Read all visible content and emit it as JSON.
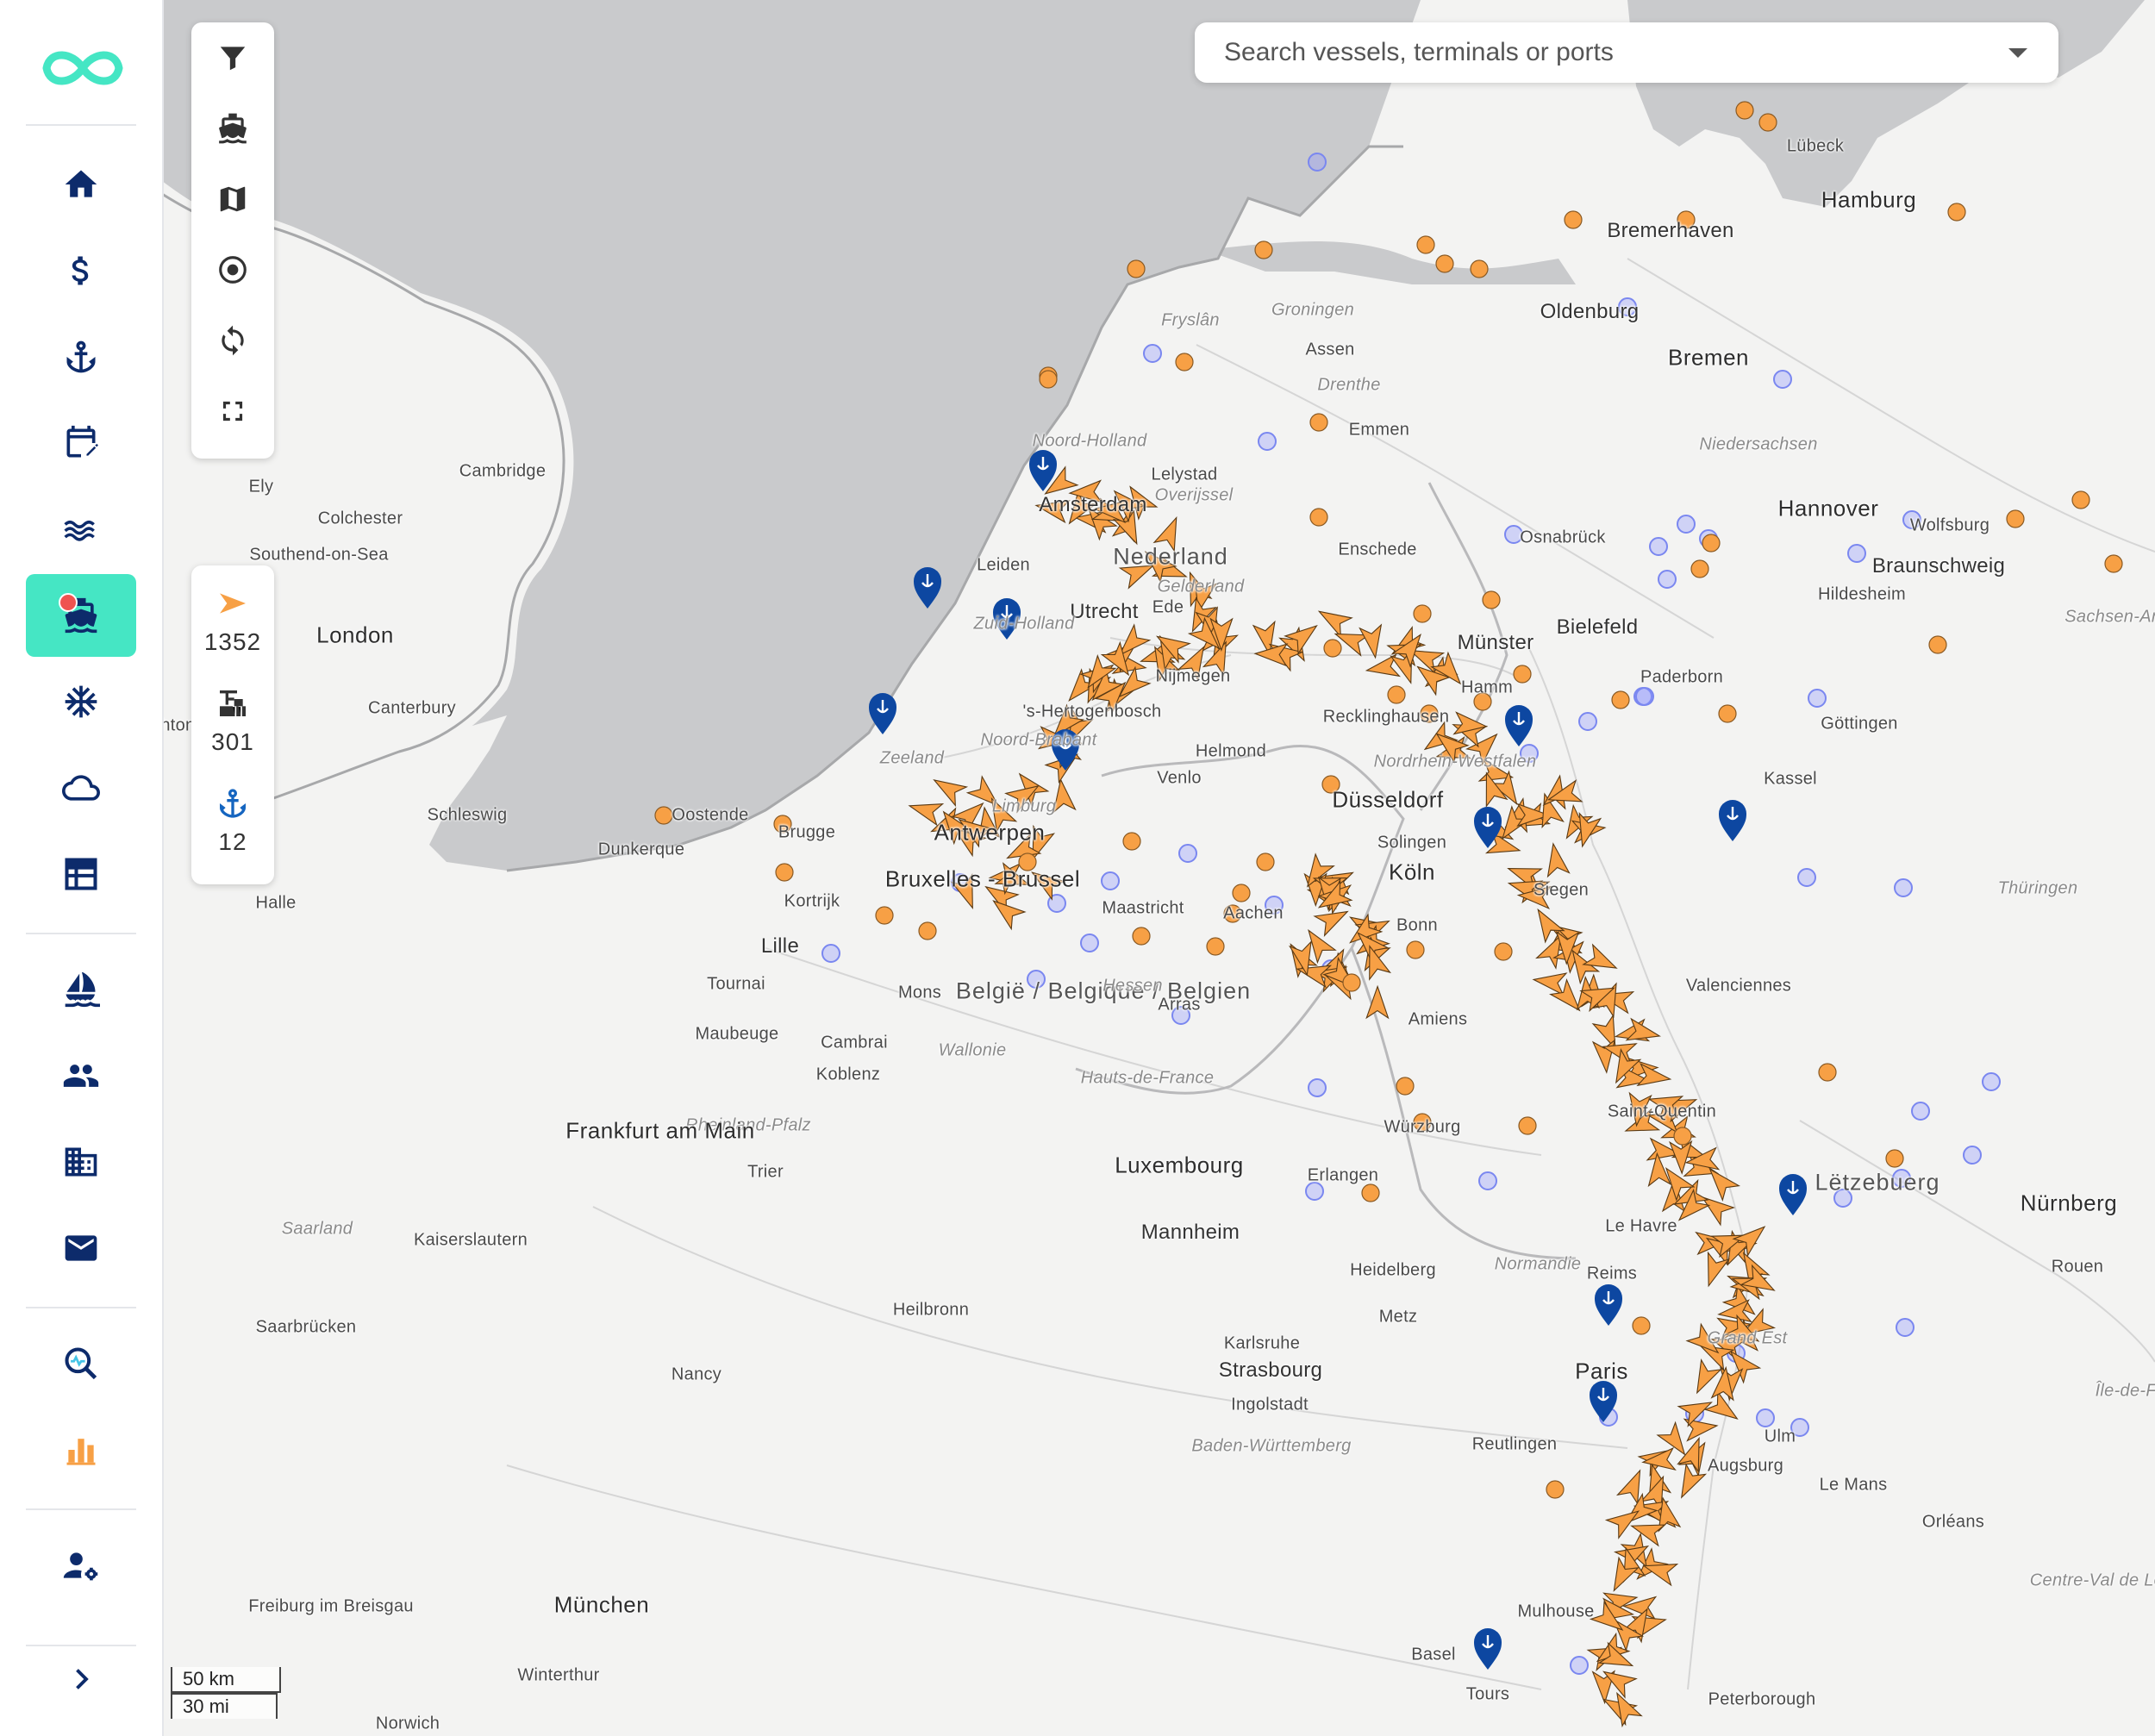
{
  "app": {
    "title": "Fleet map"
  },
  "colors": {
    "accent": "#45e6c4",
    "navy": "#0d2b6b",
    "vessel": "#f7a045",
    "terminal_marker": "#0d47a1",
    "terminal_circle": "#7a87f0",
    "water": "#c9cacc",
    "land": "#f2f2f1"
  },
  "sidebar": {
    "items": [
      {
        "name": "home-icon",
        "label": "Home"
      },
      {
        "name": "dollar-icon",
        "label": "Finance"
      },
      {
        "name": "anchor-icon",
        "label": "Ports"
      },
      {
        "name": "calendar-edit-icon",
        "label": "Planning"
      },
      {
        "name": "waves-icon",
        "label": "Water levels"
      },
      {
        "name": "ship-icon",
        "label": "Vessels",
        "active": true,
        "has_notification": true
      },
      {
        "name": "snowflake-icon",
        "label": "Ice"
      },
      {
        "name": "cloud-icon",
        "label": "Weather"
      },
      {
        "name": "table-icon",
        "label": "Timetable"
      },
      {
        "name": "sailboat-icon",
        "label": "Fleet"
      },
      {
        "name": "people-icon",
        "label": "Contacts"
      },
      {
        "name": "building-icon",
        "label": "Companies"
      },
      {
        "name": "mail-icon",
        "label": "Messages"
      },
      {
        "name": "analytics-search-icon",
        "label": "Analysis"
      },
      {
        "name": "bar-chart-icon",
        "label": "Reports"
      },
      {
        "name": "user-settings-icon",
        "label": "Account settings"
      }
    ],
    "collapse_icon": "chevron-right-icon"
  },
  "tools": [
    "filter-icon",
    "ship-icon",
    "map-icon",
    "target-icon",
    "sync-icon",
    "fullscreen-icon"
  ],
  "counts": {
    "vessels": "1352",
    "terminals": "301",
    "ports": "12"
  },
  "search": {
    "placeholder": "Search vessels, terminals or ports",
    "value": ""
  },
  "scale": {
    "km": "50 km",
    "mi": "30 mi"
  },
  "map": {
    "places": [
      {
        "label": "Hamburg",
        "type": "big"
      },
      {
        "label": "Bremen",
        "type": "big"
      },
      {
        "label": "Bremerhaven",
        "type": "city"
      },
      {
        "label": "Lübeck",
        "type": "town"
      },
      {
        "label": "Oldenburg",
        "type": "city"
      },
      {
        "label": "Groningen",
        "type": "region"
      },
      {
        "label": "Assen",
        "type": "town"
      },
      {
        "label": "Drenthe",
        "type": "region"
      },
      {
        "label": "Emmen",
        "type": "town"
      },
      {
        "label": "Fryslân",
        "type": "region"
      },
      {
        "label": "Niedersachsen",
        "type": "region"
      },
      {
        "label": "Noord-Holland",
        "type": "region"
      },
      {
        "label": "Lelystad",
        "type": "town"
      },
      {
        "label": "Overijssel",
        "type": "region"
      },
      {
        "label": "Amsterdam",
        "type": "city"
      },
      {
        "label": "Nederland",
        "type": "country"
      },
      {
        "label": "Leiden",
        "type": "town"
      },
      {
        "label": "Enschede",
        "type": "town"
      },
      {
        "label": "Osnabrück",
        "type": "town"
      },
      {
        "label": "Hannover",
        "type": "big"
      },
      {
        "label": "Wolfsburg",
        "type": "town"
      },
      {
        "label": "Braunschweig",
        "type": "city"
      },
      {
        "label": "Hildesheim",
        "type": "town"
      },
      {
        "label": "Sachsen-Anhalt",
        "type": "region"
      },
      {
        "label": "Utrecht",
        "type": "city"
      },
      {
        "label": "Ede",
        "type": "town"
      },
      {
        "label": "Gelderland",
        "type": "region"
      },
      {
        "label": "Zuid-Holland",
        "type": "region"
      },
      {
        "label": "Münster",
        "type": "city"
      },
      {
        "label": "Bielefeld",
        "type": "city"
      },
      {
        "label": "Paderborn",
        "type": "town"
      },
      {
        "label": "Hamm",
        "type": "town"
      },
      {
        "label": "Nijmegen",
        "type": "town"
      },
      {
        "label": "'s-Hertogenbosch",
        "type": "town"
      },
      {
        "label": "Noord-Brabant",
        "type": "region"
      },
      {
        "label": "Helmond",
        "type": "town"
      },
      {
        "label": "Venlo",
        "type": "town"
      },
      {
        "label": "Recklinghausen",
        "type": "town"
      },
      {
        "label": "Nordrhein-Westfalen",
        "type": "region"
      },
      {
        "label": "Göttingen",
        "type": "town"
      },
      {
        "label": "Kassel",
        "type": "town"
      },
      {
        "label": "Zeeland",
        "type": "region"
      },
      {
        "label": "Oostende",
        "type": "town"
      },
      {
        "label": "Brugge",
        "type": "town"
      },
      {
        "label": "Dunkerque",
        "type": "town"
      },
      {
        "label": "Antwerpen",
        "type": "big"
      },
      {
        "label": "Limburg",
        "type": "region"
      },
      {
        "label": "Düsseldorf",
        "type": "big"
      },
      {
        "label": "Solingen",
        "type": "town"
      },
      {
        "label": "Köln",
        "type": "big"
      },
      {
        "label": "Bruxelles - Brussel",
        "type": "big"
      },
      {
        "label": "Kortrijk",
        "type": "town"
      },
      {
        "label": "Lille",
        "type": "city"
      },
      {
        "label": "Maastricht",
        "type": "town"
      },
      {
        "label": "Aachen",
        "type": "town"
      },
      {
        "label": "Bonn",
        "type": "town"
      },
      {
        "label": "Siegen",
        "type": "town"
      },
      {
        "label": "Thüringen",
        "type": "region"
      },
      {
        "label": "Tournai",
        "type": "town"
      },
      {
        "label": "Mons",
        "type": "town"
      },
      {
        "label": "België / Belgique / Belgien",
        "type": "country"
      },
      {
        "label": "Hessen",
        "type": "region"
      },
      {
        "label": "Arras",
        "type": "town"
      },
      {
        "label": "Valenciennes",
        "type": "town"
      },
      {
        "label": "Maubeuge",
        "type": "town"
      },
      {
        "label": "Cambrai",
        "type": "town"
      },
      {
        "label": "Wallonie",
        "type": "region"
      },
      {
        "label": "Koblenz",
        "type": "town"
      },
      {
        "label": "Hauts-de-France",
        "type": "region"
      },
      {
        "label": "Amiens",
        "type": "town"
      },
      {
        "label": "Rheinland-Pfalz",
        "type": "region"
      },
      {
        "label": "Frankfurt am Main",
        "type": "big"
      },
      {
        "label": "Würzburg",
        "type": "town"
      },
      {
        "label": "Saint-Quentin",
        "type": "town"
      },
      {
        "label": "Lëtzebuerg",
        "type": "country"
      },
      {
        "label": "Trier",
        "type": "town"
      },
      {
        "label": "Luxembourg",
        "type": "big"
      },
      {
        "label": "Erlangen",
        "type": "town"
      },
      {
        "label": "Mannheim",
        "type": "city"
      },
      {
        "label": "Nürnberg",
        "type": "big"
      },
      {
        "label": "Le Havre",
        "type": "town"
      },
      {
        "label": "Rouen",
        "type": "town"
      },
      {
        "label": "Saarland",
        "type": "region"
      },
      {
        "label": "Kaiserslautern",
        "type": "town"
      },
      {
        "label": "Heidelberg",
        "type": "town"
      },
      {
        "label": "Normandie",
        "type": "region"
      },
      {
        "label": "Reims",
        "type": "town"
      },
      {
        "label": "Saarbrücken",
        "type": "town"
      },
      {
        "label": "Heilbronn",
        "type": "town"
      },
      {
        "label": "Metz",
        "type": "town"
      },
      {
        "label": "Karlsruhe",
        "type": "town"
      },
      {
        "label": "Paris",
        "type": "big"
      },
      {
        "label": "Grand Est",
        "type": "region"
      },
      {
        "label": "Ingolstadt",
        "type": "town"
      },
      {
        "label": "Île-de-France",
        "type": "region"
      },
      {
        "label": "Nancy",
        "type": "town"
      },
      {
        "label": "Strasbourg",
        "type": "city"
      },
      {
        "label": "Baden-Württemberg",
        "type": "region"
      },
      {
        "label": "Reutlingen",
        "type": "town"
      },
      {
        "label": "Ulm",
        "type": "town"
      },
      {
        "label": "Augsburg",
        "type": "town"
      },
      {
        "label": "Le Mans",
        "type": "town"
      },
      {
        "label": "Orléans",
        "type": "town"
      },
      {
        "label": "Freiburg im Breisgau",
        "type": "town"
      },
      {
        "label": "München",
        "type": "big"
      },
      {
        "label": "Mulhouse",
        "type": "town"
      },
      {
        "label": "Centre-Val de Loire",
        "type": "region"
      },
      {
        "label": "Basel",
        "type": "town"
      },
      {
        "label": "Winterthur",
        "type": "town"
      },
      {
        "label": "Tours",
        "type": "town"
      },
      {
        "label": "Peterborough",
        "type": "town"
      },
      {
        "label": "Norwich",
        "type": "town"
      },
      {
        "label": "Ely",
        "type": "town"
      },
      {
        "label": "Cambridge",
        "type": "town"
      },
      {
        "label": "Colchester",
        "type": "town"
      },
      {
        "label": "Southend-on-Sea",
        "type": "town"
      },
      {
        "label": "London",
        "type": "big"
      },
      {
        "label": "Canterbury",
        "type": "town"
      },
      {
        "label": "Brighton",
        "type": "town"
      },
      {
        "label": "Schleswig",
        "type": "town"
      },
      {
        "label": "Halle",
        "type": "town"
      }
    ]
  }
}
